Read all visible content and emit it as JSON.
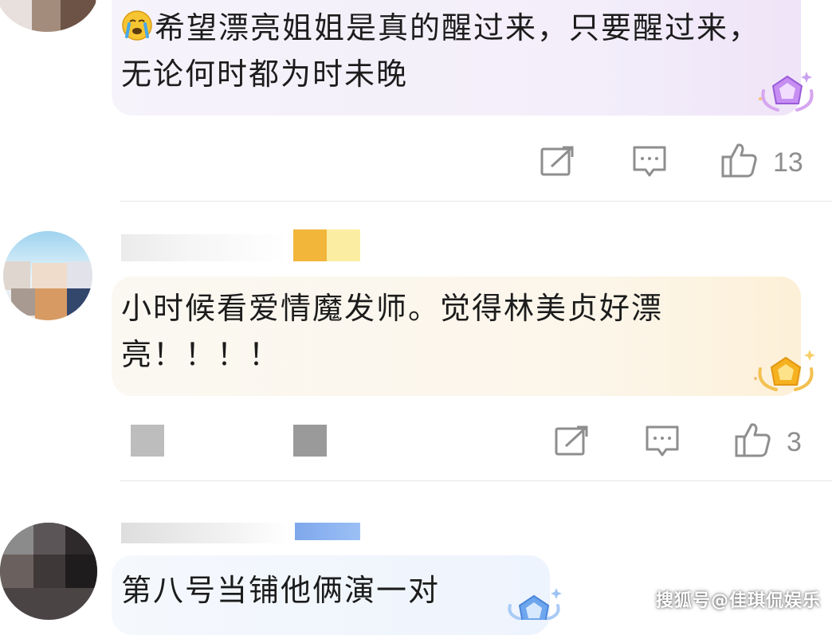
{
  "comments": [
    {
      "text": "希望漂亮姐姐是真的醒过来，只要醒过来，无论何时都为时未晚",
      "emoji": "crying-face",
      "badge": "purple-gem-badge",
      "likes": "13"
    },
    {
      "text": "小时候看爱情魔发师。觉得林美贞好漂亮！！！！",
      "badge": "gold-gem-badge",
      "likes": "3"
    },
    {
      "text": "第八号当铺他俩演一对",
      "badge": "blue-gem-badge"
    }
  ],
  "icons": {
    "share": "share-icon",
    "reply": "comment-icon",
    "like": "thumbs-up-icon"
  },
  "colors": {
    "purple_bubble": "#f3eefa",
    "gold_bubble": "#fcf6ea",
    "blue_bubble": "#eef4fd",
    "icon_gray": "#8e8e8e"
  },
  "watermark": "搜狐号@佳琪侃娱乐"
}
